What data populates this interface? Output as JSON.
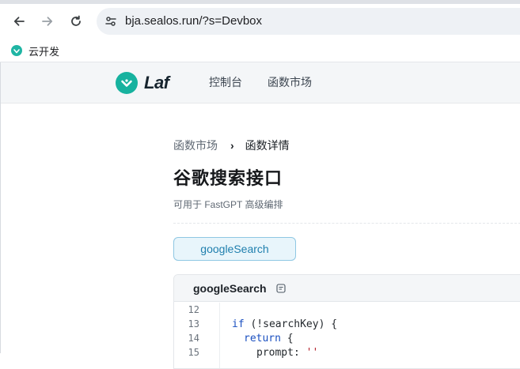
{
  "browser": {
    "url": "bja.sealos.run/?s=Devbox",
    "bookmarks": [
      {
        "label": "云开发"
      }
    ]
  },
  "site": {
    "logo_text": "Laf",
    "nav": [
      {
        "label": "控制台"
      },
      {
        "label": "函数市场"
      }
    ]
  },
  "breadcrumb": {
    "parent": "函数市场",
    "separator": "›",
    "current": "函数详情"
  },
  "function": {
    "title": "谷歌搜索接口",
    "subtitle": "可用于 FastGPT 高级编排",
    "chip_label": "googleSearch"
  },
  "code_panel": {
    "file_name": "googleSearch",
    "lines": [
      {
        "no": "12",
        "text": ""
      },
      {
        "no": "13",
        "kw1": "if",
        "p1": " (!",
        "v1": "searchKey",
        "p2": ") {"
      },
      {
        "no": "14",
        "kw1": "return",
        "p1": " {"
      },
      {
        "no": "15",
        "v1": "prompt",
        "p1": ": ",
        "s1": "''"
      }
    ]
  },
  "colors": {
    "accent": "#17b29f",
    "chip_bg": "#e8f5fb",
    "chip_border": "#8fc7e3",
    "chip_text": "#1f7fae"
  }
}
